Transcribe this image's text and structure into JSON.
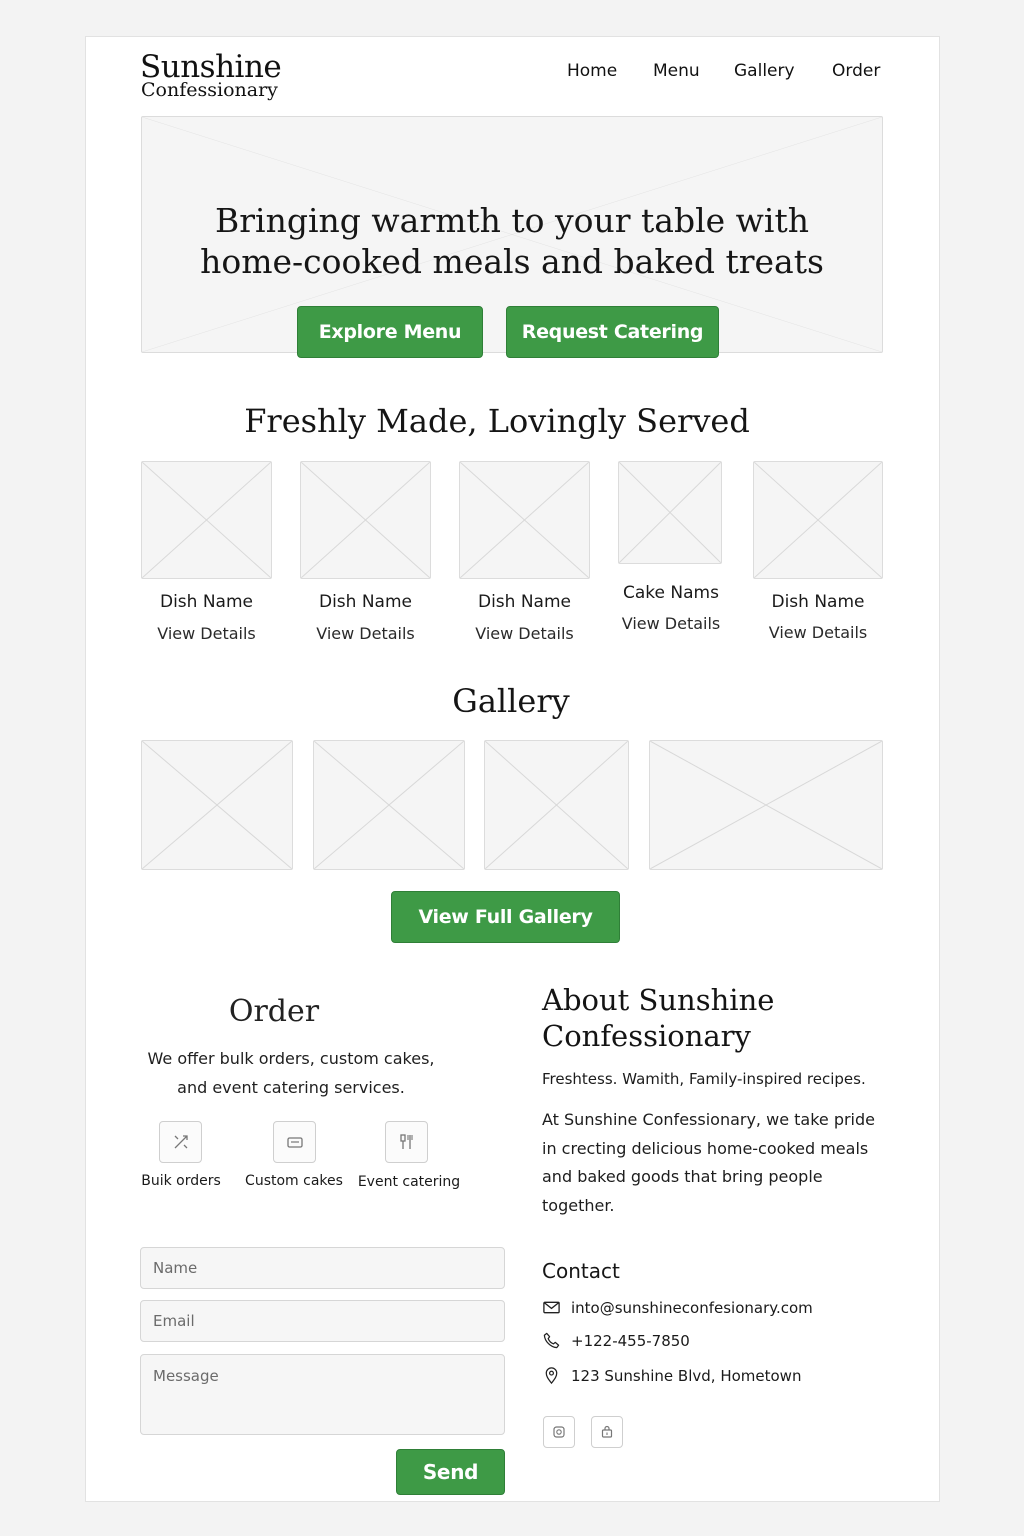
{
  "header": {
    "logo_line1": "Sunshine",
    "logo_line2": "Confessionary",
    "nav": [
      "Home",
      "Menu",
      "Gallery",
      "Order"
    ]
  },
  "hero": {
    "title_line1": "Bringing warmth to your table with",
    "title_line2": "home-cooked meals and baked treats",
    "primary_button": "Explore Menu",
    "secondary_button": "Request Catering"
  },
  "featured": {
    "title": "Freshly Made, Lovingly Served",
    "items": [
      {
        "name": "Dish Name",
        "link": "View Details"
      },
      {
        "name": "Dish Name",
        "link": "View Details"
      },
      {
        "name": "Dish Name",
        "link": "View Details"
      },
      {
        "name": "Cake Nams",
        "link": "View Details"
      },
      {
        "name": "Dish Name",
        "link": "View Details"
      }
    ]
  },
  "gallery": {
    "title": "Gallery",
    "button": "View Full Gallery"
  },
  "order": {
    "title": "Order",
    "desc_line1": "We offer bulk orders, custom cakes,",
    "desc_line2": "and event catering services.",
    "services": [
      {
        "label": "Buik orders",
        "icon": "bulk-orders-icon"
      },
      {
        "label": "Custom cakes",
        "icon": "custom-cakes-icon"
      },
      {
        "label": "Event catering",
        "icon": "event-catering-icon"
      }
    ],
    "form": {
      "name_placeholder": "Name",
      "email_placeholder": "Email",
      "message_placeholder": "Message",
      "send_label": "Send"
    }
  },
  "about": {
    "title_line1": "About Sunshine",
    "title_line2": "Confessionary",
    "tagline": "Freshtess. Wamith, Family-inspired recipes.",
    "body": "At Sunshine Confessionary, we take pride in crecting delicious home-cooked meals and baked goods that bring people together."
  },
  "contact": {
    "title": "Contact",
    "email": "into@sunshineconfesionary.com",
    "phone": "+122-455-7850",
    "address": "123 Sunshine Blvd, Hometown"
  },
  "colors": {
    "accent": "#3e9a46",
    "placeholder_fill": "#f5f5f5",
    "placeholder_border": "#dcdcdc"
  }
}
